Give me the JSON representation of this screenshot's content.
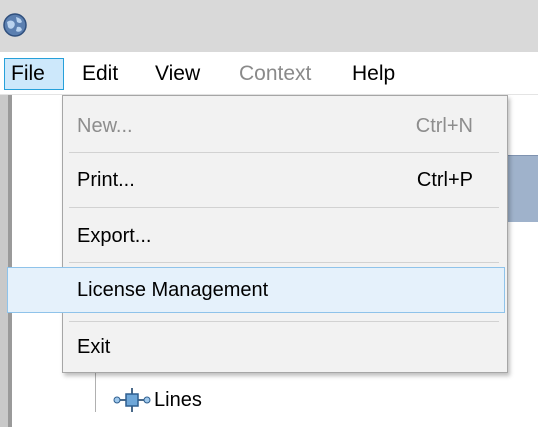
{
  "menubar": {
    "items": [
      {
        "label": "File",
        "state": "open"
      },
      {
        "label": "Edit",
        "state": "normal"
      },
      {
        "label": "View",
        "state": "normal"
      },
      {
        "label": "Context",
        "state": "disabled"
      },
      {
        "label": "Help",
        "state": "normal"
      }
    ]
  },
  "file_menu": {
    "new_label": "New...",
    "new_shortcut": "Ctrl+N",
    "print_label": "Print...",
    "print_shortcut": "Ctrl+P",
    "export_label": "Export...",
    "license_label": "License Management",
    "exit_label": "Exit"
  },
  "tree": {
    "lines_label": "Lines"
  },
  "colors": {
    "menu_open_bg": "#cde8fb",
    "menu_open_border": "#26a0da",
    "highlight_bg": "#e5f1fb",
    "highlight_border": "#8fc3ea",
    "disabled_text": "#8d8d8d"
  },
  "icons": {
    "app": "globe-icon",
    "tree_item": "network-node-icon"
  }
}
